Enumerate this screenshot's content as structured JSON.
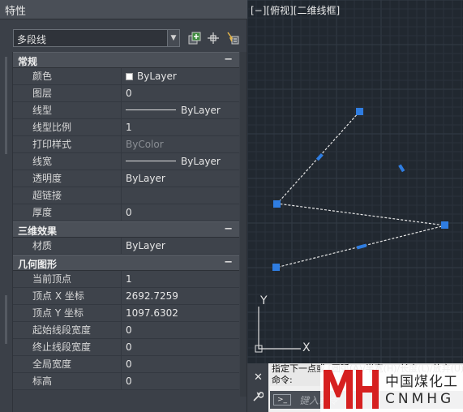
{
  "palette": {
    "title": "特性",
    "object_type": "多段线",
    "sections": [
      {
        "title": "常规",
        "toggle": "−",
        "rows": [
          {
            "name": "颜色",
            "value": "ByLayer",
            "kind": "swatch"
          },
          {
            "name": "图层",
            "value": "0"
          },
          {
            "name": "线型",
            "value": "ByLayer",
            "kind": "line"
          },
          {
            "name": "线型比例",
            "value": "1"
          },
          {
            "name": "打印样式",
            "value": "ByColor",
            "kind": "dim"
          },
          {
            "name": "线宽",
            "value": "ByLayer",
            "kind": "line"
          },
          {
            "name": "透明度",
            "value": "ByLayer"
          },
          {
            "name": "超链接",
            "value": ""
          },
          {
            "name": "厚度",
            "value": "0"
          }
        ]
      },
      {
        "title": "三维效果",
        "toggle": "−",
        "rows": [
          {
            "name": "材质",
            "value": "ByLayer"
          }
        ]
      },
      {
        "title": "几何图形",
        "toggle": "−",
        "rows": [
          {
            "name": "当前顶点",
            "value": "1"
          },
          {
            "name": "顶点 X 坐标",
            "value": "2692.7259"
          },
          {
            "name": "顶点 Y 坐标",
            "value": "1097.6302"
          },
          {
            "name": "起始线段宽度",
            "value": "0"
          },
          {
            "name": "终止线段宽度",
            "value": "0"
          },
          {
            "name": "全局宽度",
            "value": "0"
          },
          {
            "name": "标高",
            "value": "0"
          }
        ]
      }
    ]
  },
  "viewport": {
    "label": "[−][俯视][二维线框]",
    "ucs_x": "X",
    "ucs_y": "Y"
  },
  "command_line": {
    "history_1": "指定下一点或 [圆弧(A)/半宽(H)/长度(L)/放弃(U)/宽度(W)]:",
    "history_2": "命令:",
    "placeholder": "键入命令",
    "prompt_icon": ">_"
  },
  "watermark": {
    "logo_text": "MH",
    "cn": "中国煤化工",
    "en": "CNMHG"
  },
  "colors": {
    "grip": "#2f7de1",
    "polyline": "#e6e6e6",
    "grid_minor": "#2a323c",
    "grid_major": "#323b46"
  }
}
